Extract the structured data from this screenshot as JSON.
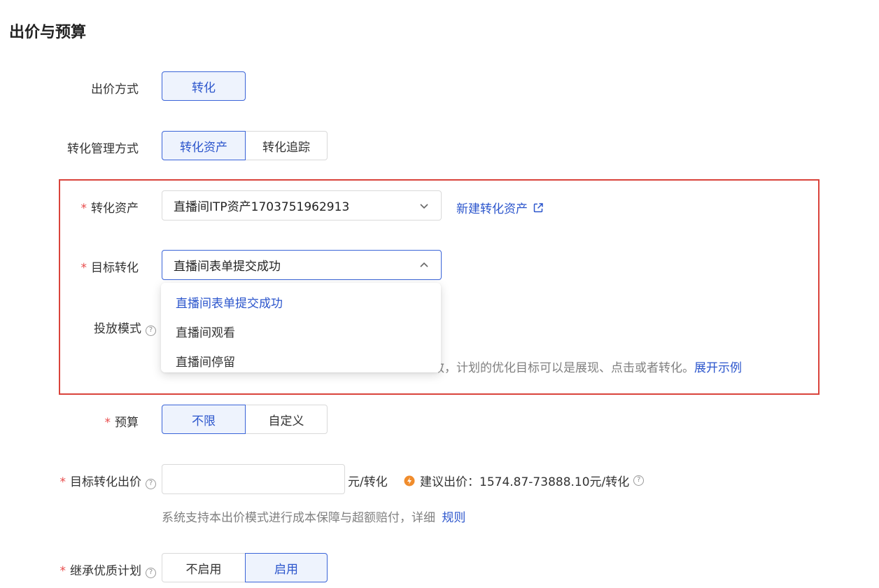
{
  "section_title": "出价与预算",
  "bid_method": {
    "label": "出价方式",
    "options": [
      "转化"
    ]
  },
  "conversion_mgmt": {
    "label": "转化管理方式",
    "options": [
      "转化资产",
      "转化追踪"
    ]
  },
  "conversion_asset": {
    "label": "转化资产",
    "value": "直播间ITP资产1703751962913",
    "new_link": "新建转化资产"
  },
  "target_conversion": {
    "label": "目标转化",
    "value": "直播间表单提交成功",
    "options": [
      "直播间表单提交成功",
      "直播间观看",
      "直播间停留"
    ]
  },
  "delivery_mode": {
    "label": "投放模式",
    "help": "?",
    "hint_tail": "效，计划的优化目标可以是展现、点击或者转化。",
    "expand_link": "展开示例"
  },
  "budget": {
    "label": "预算",
    "options": [
      "不限",
      "自定义"
    ]
  },
  "target_bid": {
    "label": "目标转化出价",
    "value": "",
    "unit": "元/转化",
    "suggest_prefix": "建议出价：",
    "suggest_value": "1574.87-73888.10元/转化",
    "note": "系统支持本出价模式进行成本保障与超额赔付，详细",
    "rules_link": "规则"
  },
  "inherit_plan": {
    "label": "继承优质计划",
    "options": [
      "不启用",
      "启用"
    ]
  },
  "required_mark": "*",
  "colors": {
    "accent": "#2b55cc",
    "highlight_border": "#d9433b",
    "required": "#e84b4b",
    "warning": "#f08c2c"
  }
}
